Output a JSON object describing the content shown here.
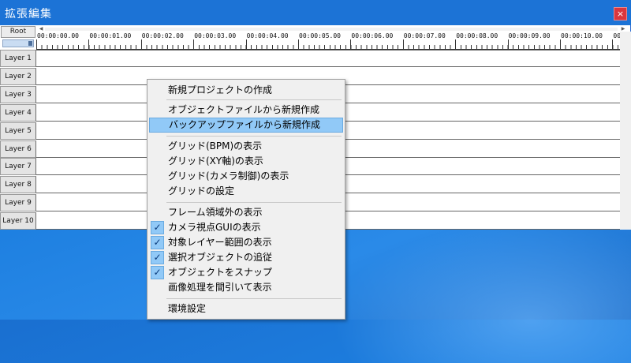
{
  "window": {
    "title": "拡張編集",
    "close_label": "×"
  },
  "header": {
    "root_label": "Root",
    "scroll_left": "◀",
    "scroll_right": "▶",
    "timestamps": [
      "00:00:00.00",
      "00:00:01.00",
      "00:00:02.00",
      "00:00:03.00",
      "00:00:04.00",
      "00:00:05.00",
      "00:00:06.00",
      "00:00:07.00",
      "00:00:08.00",
      "00:00:09.00",
      "00:00:10.00",
      "00"
    ]
  },
  "layers": [
    "Layer 1",
    "Layer 2",
    "Layer 3",
    "Layer 4",
    "Layer 5",
    "Layer 6",
    "Layer 7",
    "Layer 8",
    "Layer 9",
    "Layer 10"
  ],
  "menu": {
    "items": [
      {
        "label": "新規プロジェクトの作成",
        "checked": false,
        "highlighted": false
      },
      {
        "label": "オブジェクトファイルから新規作成",
        "checked": false,
        "highlighted": false
      },
      {
        "label": "バックアップファイルから新規作成",
        "checked": false,
        "highlighted": true
      },
      {
        "label": "グリッド(BPM)の表示",
        "checked": false,
        "highlighted": false
      },
      {
        "label": "グリッド(XY軸)の表示",
        "checked": false,
        "highlighted": false
      },
      {
        "label": "グリッド(カメラ制御)の表示",
        "checked": false,
        "highlighted": false
      },
      {
        "label": "グリッドの設定",
        "checked": false,
        "highlighted": false
      },
      {
        "label": "フレーム領域外の表示",
        "checked": false,
        "highlighted": false
      },
      {
        "label": "カメラ視点GUIの表示",
        "checked": true,
        "highlighted": false
      },
      {
        "label": "対象レイヤー範囲の表示",
        "checked": true,
        "highlighted": false
      },
      {
        "label": "選択オブジェクトの追従",
        "checked": true,
        "highlighted": false
      },
      {
        "label": "オブジェクトをスナップ",
        "checked": true,
        "highlighted": false
      },
      {
        "label": "画像処理を間引いて表示",
        "checked": false,
        "highlighted": false
      },
      {
        "label": "環境設定",
        "checked": false,
        "highlighted": false
      }
    ],
    "check_glyph": "✓"
  },
  "colors": {
    "titlebar": "#1c73d6",
    "menu_highlight": "#91c9f7",
    "desktop": "#1d7fe0"
  }
}
